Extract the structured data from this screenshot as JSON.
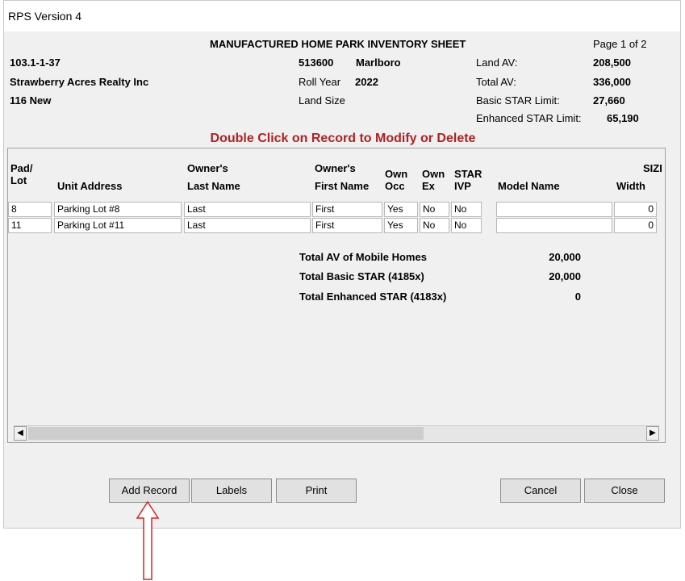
{
  "window": {
    "title": "RPS Version 4"
  },
  "header": {
    "sheet_title": "MANUFACTURED HOME PARK INVENTORY SHEET",
    "page": "Page 1 of 2",
    "parcel_id": "103.1-1-37",
    "owner_name": "Strawberry Acres Realty Inc",
    "address": "116 New",
    "swis": "513600",
    "municipality": "Marlboro",
    "roll_year_label": "Roll Year",
    "roll_year": "2022",
    "land_size_label": "Land Size",
    "land_av_label": "Land AV:",
    "land_av": "208,500",
    "total_av_label": "Total AV:",
    "total_av": "336,000",
    "basic_star_label": "Basic STAR Limit:",
    "basic_star": "27,660",
    "enhanced_star_label": "Enhanced STAR Limit:",
    "enhanced_star": "65,190"
  },
  "instruction": "Double Click on Record to Modify or Delete",
  "columns": {
    "pad_1": "Pad/",
    "pad_2": "Lot",
    "unit_address": "Unit Address",
    "owner_last_1": "Owner's",
    "owner_last_2": "Last Name",
    "owner_first_1": "Owner's",
    "owner_first_2": "First Name",
    "own_occ_1": "Own",
    "own_occ_2": "Occ",
    "own_ex_1": "Own",
    "own_ex_2": "Ex",
    "star_ivp_1": "STAR",
    "star_ivp_2": "IVP",
    "model_name": "Model Name",
    "size": "SIZI",
    "width": "Width"
  },
  "rows": [
    {
      "pad": "8",
      "address": "Parking Lot #8",
      "last": "Last",
      "first": "First",
      "occ": "Yes",
      "ex": "No",
      "ivp": "No",
      "model": "",
      "width": "0"
    },
    {
      "pad": "11",
      "address": "Parking Lot #11",
      "last": "Last",
      "first": "First",
      "occ": "Yes",
      "ex": "No",
      "ivp": "No",
      "model": "",
      "width": "0"
    }
  ],
  "totals": {
    "av_label": "Total AV of Mobile Homes",
    "av_value": "20,000",
    "basic_label": "Total Basic STAR (4185x)",
    "basic_value": "20,000",
    "enhanced_label": "Total Enhanced STAR (4183x)",
    "enhanced_value": "0"
  },
  "buttons": {
    "add_record": "Add Record",
    "labels": "Labels",
    "print": "Print",
    "cancel": "Cancel",
    "close": "Close"
  },
  "icons": {
    "scroll_left": "left-arrow-icon",
    "scroll_right": "right-arrow-icon",
    "annotation": "up-arrow-icon"
  },
  "colors": {
    "instruction": "#b22020",
    "annotation_arrow": "#e02020"
  }
}
